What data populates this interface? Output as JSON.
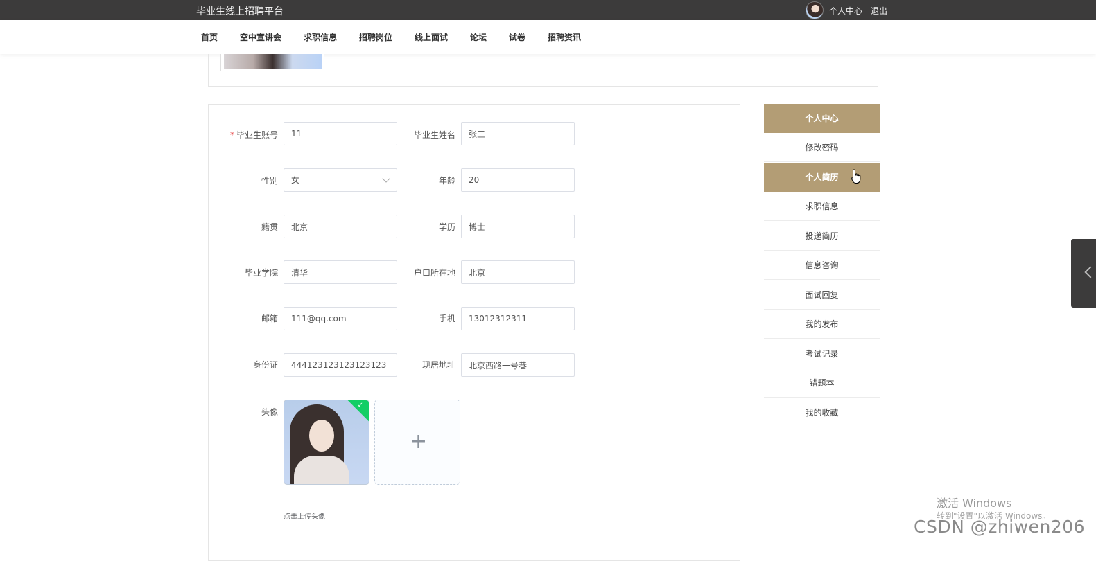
{
  "header": {
    "site_title": "毕业生线上招聘平台",
    "personal_center": "个人中心",
    "logout": "退出"
  },
  "nav": {
    "items": [
      "首页",
      "空中宣讲会",
      "求职信息",
      "招聘岗位",
      "线上面试",
      "论坛",
      "试卷",
      "招聘资讯"
    ]
  },
  "form": {
    "fields": [
      {
        "label": "毕业生账号",
        "value": "11",
        "required": true
      },
      {
        "label": "毕业生姓名",
        "value": "张三"
      },
      {
        "label": "性别",
        "value": "女"
      },
      {
        "label": "年龄",
        "value": "20"
      },
      {
        "label": "籍贯",
        "value": "北京"
      },
      {
        "label": "学历",
        "value": "博士"
      },
      {
        "label": "毕业学院",
        "value": "清华"
      },
      {
        "label": "户口所在地",
        "value": "北京"
      },
      {
        "label": "邮箱",
        "value": "111@qq.com"
      },
      {
        "label": "手机",
        "value": "13012312311"
      },
      {
        "label": "身份证",
        "value": "444123123123123123"
      },
      {
        "label": "现居地址",
        "value": "北京西路一号巷"
      }
    ],
    "required_mark": "*",
    "avatar_label": "头像",
    "upload_tip": "点击上传头像",
    "plus": "+"
  },
  "sidebar": {
    "items": [
      {
        "label": "个人中心",
        "active": true
      },
      {
        "label": "修改密码",
        "active": false
      },
      {
        "label": "个人简历",
        "active": true
      },
      {
        "label": "求职信息",
        "active": false
      },
      {
        "label": "投递简历",
        "active": false
      },
      {
        "label": "信息咨询",
        "active": false
      },
      {
        "label": "面试回复",
        "active": false
      },
      {
        "label": "我的发布",
        "active": false
      },
      {
        "label": "考试记录",
        "active": false
      },
      {
        "label": "错题本",
        "active": false
      },
      {
        "label": "我的收藏",
        "active": false
      }
    ]
  },
  "watermark": {
    "windows_title": "激活 Windows",
    "windows_sub": "转到\"设置\"以激活 Windows。",
    "csdn": "CSDN @zhiwen206"
  },
  "colors": {
    "topbar": "#3c3b3b",
    "accent": "#b39d75",
    "success": "#13ce66"
  }
}
